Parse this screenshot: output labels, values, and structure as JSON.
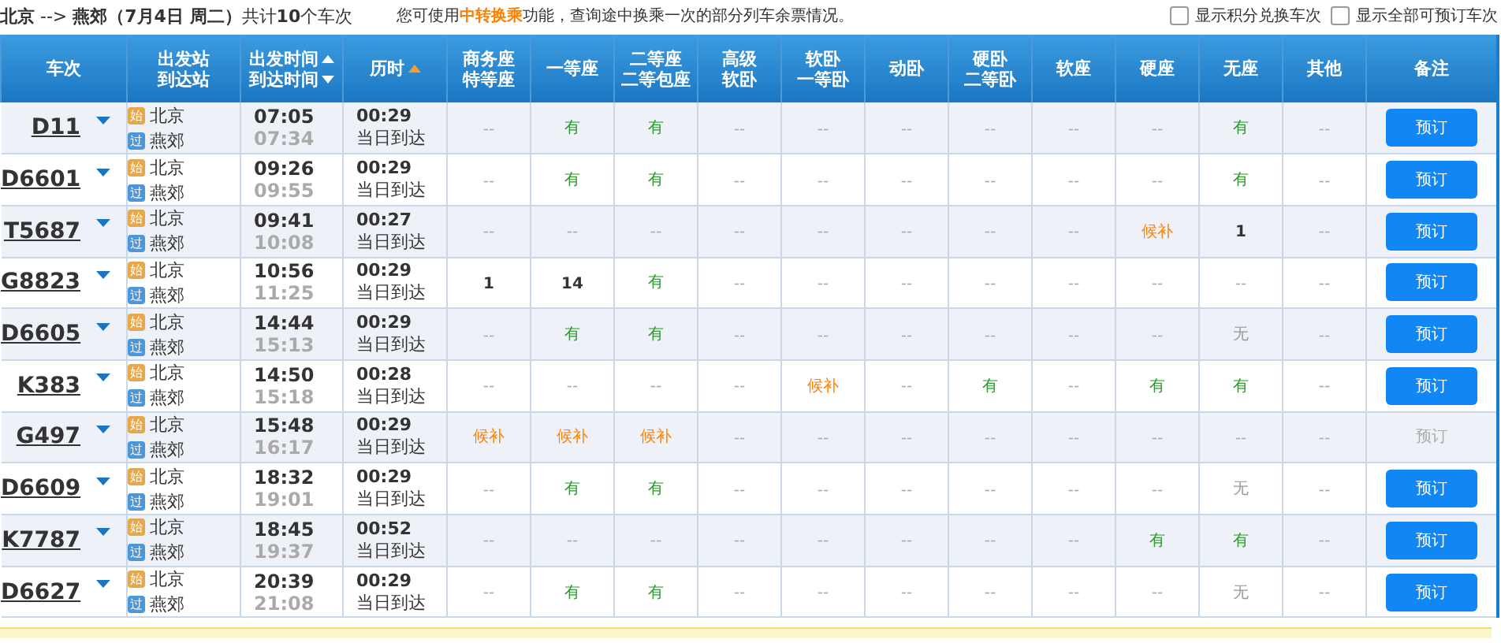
{
  "summary": "**北京** --> **燕郊（7月4日  周二）**共计**10**个车次",
  "notice": {
    "before": "您可使用",
    "link": "中转换乘",
    "after": "功能，查询途中换乘一次的部分列车余票情况。"
  },
  "options": [
    {
      "label": "显示积分兑换车次",
      "checked": false
    },
    {
      "label": "显示全部可预订车次",
      "checked": false
    }
  ],
  "columns": [
    {
      "lines": [
        "车次"
      ],
      "kind": "plain"
    },
    {
      "lines": [
        "出发站",
        "到达站"
      ],
      "kind": "plain"
    },
    {
      "lines": [
        "出发时间",
        "到达时间"
      ],
      "kind": "sortable"
    },
    {
      "lines": [
        "历时"
      ],
      "kind": "sorted"
    },
    {
      "lines": [
        "商务座",
        "特等座"
      ],
      "kind": "plain"
    },
    {
      "lines": [
        "一等座"
      ],
      "kind": "plain"
    },
    {
      "lines": [
        "二等座",
        "二等包座"
      ],
      "kind": "plain"
    },
    {
      "lines": [
        "高级",
        "软卧"
      ],
      "kind": "plain"
    },
    {
      "lines": [
        "软卧",
        "一等卧"
      ],
      "kind": "plain"
    },
    {
      "lines": [
        "动卧"
      ],
      "kind": "plain"
    },
    {
      "lines": [
        "硬卧",
        "二等卧"
      ],
      "kind": "plain"
    },
    {
      "lines": [
        "软座"
      ],
      "kind": "plain"
    },
    {
      "lines": [
        "硬座"
      ],
      "kind": "plain"
    },
    {
      "lines": [
        "无座"
      ],
      "kind": "plain"
    },
    {
      "lines": [
        "其他"
      ],
      "kind": "plain"
    },
    {
      "lines": [
        "备注"
      ],
      "kind": "plain"
    }
  ],
  "trains": [
    {
      "number": "D11",
      "from_badge": "始",
      "from": "北京",
      "to_badge": "过",
      "to": "燕郊",
      "depart": "07:05",
      "arrive": "07:34",
      "duration": "00:29",
      "arrival_day": "当日到达",
      "seats": [
        {
          "text": "--",
          "kind": "none"
        },
        {
          "text": "有",
          "kind": "available"
        },
        {
          "text": "有",
          "kind": "available"
        },
        {
          "text": "--",
          "kind": "none"
        },
        {
          "text": "--",
          "kind": "none"
        },
        {
          "text": "--",
          "kind": "none"
        },
        {
          "text": "--",
          "kind": "none"
        },
        {
          "text": "--",
          "kind": "none"
        },
        {
          "text": "--",
          "kind": "none"
        },
        {
          "text": "有",
          "kind": "available"
        },
        {
          "text": "--",
          "kind": "none"
        }
      ],
      "book": "预订",
      "bookable": true
    },
    {
      "number": "D6601",
      "from_badge": "始",
      "from": "北京",
      "to_badge": "过",
      "to": "燕郊",
      "depart": "09:26",
      "arrive": "09:55",
      "duration": "00:29",
      "arrival_day": "当日到达",
      "seats": [
        {
          "text": "--",
          "kind": "none"
        },
        {
          "text": "有",
          "kind": "available"
        },
        {
          "text": "有",
          "kind": "available"
        },
        {
          "text": "--",
          "kind": "none"
        },
        {
          "text": "--",
          "kind": "none"
        },
        {
          "text": "--",
          "kind": "none"
        },
        {
          "text": "--",
          "kind": "none"
        },
        {
          "text": "--",
          "kind": "none"
        },
        {
          "text": "--",
          "kind": "none"
        },
        {
          "text": "有",
          "kind": "available"
        },
        {
          "text": "--",
          "kind": "none"
        }
      ],
      "book": "预订",
      "bookable": true
    },
    {
      "number": "T5687",
      "from_badge": "始",
      "from": "北京",
      "to_badge": "过",
      "to": "燕郊",
      "depart": "09:41",
      "arrive": "10:08",
      "duration": "00:27",
      "arrival_day": "当日到达",
      "seats": [
        {
          "text": "--",
          "kind": "none"
        },
        {
          "text": "--",
          "kind": "none"
        },
        {
          "text": "--",
          "kind": "none"
        },
        {
          "text": "--",
          "kind": "none"
        },
        {
          "text": "--",
          "kind": "none"
        },
        {
          "text": "--",
          "kind": "none"
        },
        {
          "text": "--",
          "kind": "none"
        },
        {
          "text": "--",
          "kind": "none"
        },
        {
          "text": "候补",
          "kind": "waitlist"
        },
        {
          "text": "1",
          "kind": "count"
        },
        {
          "text": "--",
          "kind": "none"
        }
      ],
      "book": "预订",
      "bookable": true
    },
    {
      "number": "G8823",
      "from_badge": "始",
      "from": "北京",
      "to_badge": "过",
      "to": "燕郊",
      "depart": "10:56",
      "arrive": "11:25",
      "duration": "00:29",
      "arrival_day": "当日到达",
      "seats": [
        {
          "text": "1",
          "kind": "count"
        },
        {
          "text": "14",
          "kind": "count"
        },
        {
          "text": "有",
          "kind": "available"
        },
        {
          "text": "--",
          "kind": "none"
        },
        {
          "text": "--",
          "kind": "none"
        },
        {
          "text": "--",
          "kind": "none"
        },
        {
          "text": "--",
          "kind": "none"
        },
        {
          "text": "--",
          "kind": "none"
        },
        {
          "text": "--",
          "kind": "none"
        },
        {
          "text": "--",
          "kind": "none"
        },
        {
          "text": "--",
          "kind": "none"
        }
      ],
      "book": "预订",
      "bookable": true
    },
    {
      "number": "D6605",
      "from_badge": "始",
      "from": "北京",
      "to_badge": "过",
      "to": "燕郊",
      "depart": "14:44",
      "arrive": "15:13",
      "duration": "00:29",
      "arrival_day": "当日到达",
      "seats": [
        {
          "text": "--",
          "kind": "none"
        },
        {
          "text": "有",
          "kind": "available"
        },
        {
          "text": "有",
          "kind": "available"
        },
        {
          "text": "--",
          "kind": "none"
        },
        {
          "text": "--",
          "kind": "none"
        },
        {
          "text": "--",
          "kind": "none"
        },
        {
          "text": "--",
          "kind": "none"
        },
        {
          "text": "--",
          "kind": "none"
        },
        {
          "text": "--",
          "kind": "none"
        },
        {
          "text": "无",
          "kind": "soldout"
        },
        {
          "text": "--",
          "kind": "none"
        }
      ],
      "book": "预订",
      "bookable": true
    },
    {
      "number": "K383",
      "from_badge": "始",
      "from": "北京",
      "to_badge": "过",
      "to": "燕郊",
      "depart": "14:50",
      "arrive": "15:18",
      "duration": "00:28",
      "arrival_day": "当日到达",
      "seats": [
        {
          "text": "--",
          "kind": "none"
        },
        {
          "text": "--",
          "kind": "none"
        },
        {
          "text": "--",
          "kind": "none"
        },
        {
          "text": "--",
          "kind": "none"
        },
        {
          "text": "候补",
          "kind": "waitlist"
        },
        {
          "text": "--",
          "kind": "none"
        },
        {
          "text": "有",
          "kind": "available"
        },
        {
          "text": "--",
          "kind": "none"
        },
        {
          "text": "有",
          "kind": "available"
        },
        {
          "text": "有",
          "kind": "available"
        },
        {
          "text": "--",
          "kind": "none"
        }
      ],
      "book": "预订",
      "bookable": true
    },
    {
      "number": "G497",
      "from_badge": "始",
      "from": "北京",
      "to_badge": "过",
      "to": "燕郊",
      "depart": "15:48",
      "arrive": "16:17",
      "duration": "00:29",
      "arrival_day": "当日到达",
      "seats": [
        {
          "text": "候补",
          "kind": "waitlist"
        },
        {
          "text": "候补",
          "kind": "waitlist"
        },
        {
          "text": "候补",
          "kind": "waitlist"
        },
        {
          "text": "--",
          "kind": "none"
        },
        {
          "text": "--",
          "kind": "none"
        },
        {
          "text": "--",
          "kind": "none"
        },
        {
          "text": "--",
          "kind": "none"
        },
        {
          "text": "--",
          "kind": "none"
        },
        {
          "text": "--",
          "kind": "none"
        },
        {
          "text": "--",
          "kind": "none"
        },
        {
          "text": "--",
          "kind": "none"
        }
      ],
      "book": "预订",
      "bookable": false
    },
    {
      "number": "D6609",
      "from_badge": "始",
      "from": "北京",
      "to_badge": "过",
      "to": "燕郊",
      "depart": "18:32",
      "arrive": "19:01",
      "duration": "00:29",
      "arrival_day": "当日到达",
      "seats": [
        {
          "text": "--",
          "kind": "none"
        },
        {
          "text": "有",
          "kind": "available"
        },
        {
          "text": "有",
          "kind": "available"
        },
        {
          "text": "--",
          "kind": "none"
        },
        {
          "text": "--",
          "kind": "none"
        },
        {
          "text": "--",
          "kind": "none"
        },
        {
          "text": "--",
          "kind": "none"
        },
        {
          "text": "--",
          "kind": "none"
        },
        {
          "text": "--",
          "kind": "none"
        },
        {
          "text": "无",
          "kind": "soldout"
        },
        {
          "text": "--",
          "kind": "none"
        }
      ],
      "book": "预订",
      "bookable": true
    },
    {
      "number": "K7787",
      "from_badge": "始",
      "from": "北京",
      "to_badge": "过",
      "to": "燕郊",
      "depart": "18:45",
      "arrive": "19:37",
      "duration": "00:52",
      "arrival_day": "当日到达",
      "seats": [
        {
          "text": "--",
          "kind": "none"
        },
        {
          "text": "--",
          "kind": "none"
        },
        {
          "text": "--",
          "kind": "none"
        },
        {
          "text": "--",
          "kind": "none"
        },
        {
          "text": "--",
          "kind": "none"
        },
        {
          "text": "--",
          "kind": "none"
        },
        {
          "text": "--",
          "kind": "none"
        },
        {
          "text": "--",
          "kind": "none"
        },
        {
          "text": "有",
          "kind": "available"
        },
        {
          "text": "有",
          "kind": "available"
        },
        {
          "text": "--",
          "kind": "none"
        }
      ],
      "book": "预订",
      "bookable": true
    },
    {
      "number": "D6627",
      "from_badge": "始",
      "from": "北京",
      "to_badge": "过",
      "to": "燕郊",
      "depart": "20:39",
      "arrive": "21:08",
      "duration": "00:29",
      "arrival_day": "当日到达",
      "seats": [
        {
          "text": "--",
          "kind": "none"
        },
        {
          "text": "有",
          "kind": "available"
        },
        {
          "text": "有",
          "kind": "available"
        },
        {
          "text": "--",
          "kind": "none"
        },
        {
          "text": "--",
          "kind": "none"
        },
        {
          "text": "--",
          "kind": "none"
        },
        {
          "text": "--",
          "kind": "none"
        },
        {
          "text": "--",
          "kind": "none"
        },
        {
          "text": "--",
          "kind": "none"
        },
        {
          "text": "无",
          "kind": "soldout"
        },
        {
          "text": "--",
          "kind": "none"
        }
      ],
      "book": "预订",
      "bookable": true
    }
  ]
}
